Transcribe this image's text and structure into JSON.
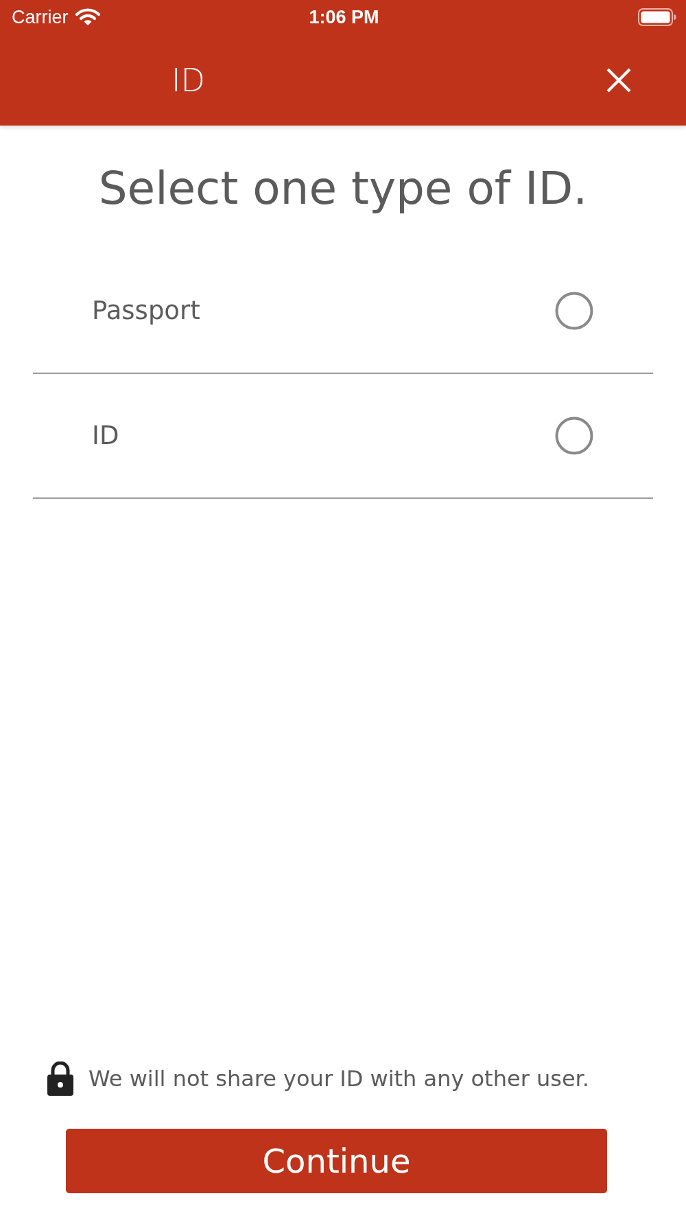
{
  "status_bar": {
    "carrier": "Carrier",
    "time": "1:06 PM"
  },
  "header": {
    "title": "ID"
  },
  "heading": "Select one type of ID.",
  "options": [
    {
      "label": "Passport",
      "selected": false
    },
    {
      "label": "ID",
      "selected": false
    }
  ],
  "notice": "We will not share your ID with any other user.",
  "continue_button": "Continue"
}
